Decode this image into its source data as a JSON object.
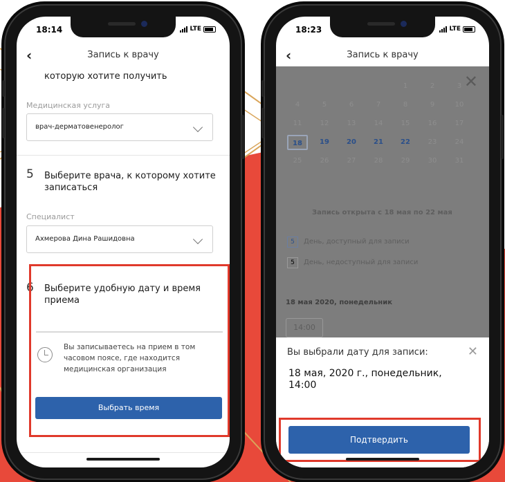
{
  "left_phone": {
    "status": {
      "time": "18:14",
      "network": "LTE"
    },
    "header": {
      "title": "Запись к врачу"
    },
    "step4": {
      "title_tail": "которую хотите получить",
      "field_label": "Медицинская услуга",
      "select_value": "врач-дерматовенеролог"
    },
    "step5": {
      "number": "5",
      "title": "Выберите врача, к которому хотите записаться",
      "field_label": "Специалист",
      "select_value": "Ахмерова Дина Рашидовна"
    },
    "step6": {
      "number": "6",
      "title": "Выберите удобную дату и время приема",
      "info": "Вы записываетесь на прием в том часовом поясе, где находится медицинская организация",
      "button": "Выбрать время"
    }
  },
  "right_phone": {
    "status": {
      "time": "18:23",
      "network": "LTE"
    },
    "header": {
      "title": "Запись к врачу"
    },
    "calendar": {
      "rows": [
        [
          "",
          "",
          "",
          "",
          "1",
          "2",
          "3"
        ],
        [
          "4",
          "5",
          "6",
          "7",
          "8",
          "9",
          "10"
        ],
        [
          "11",
          "12",
          "13",
          "14",
          "15",
          "16",
          "17"
        ],
        [
          "18",
          "19",
          "20",
          "21",
          "22",
          "23",
          "24"
        ],
        [
          "25",
          "26",
          "27",
          "28",
          "29",
          "30",
          "31"
        ]
      ],
      "available": [
        "18",
        "19",
        "20",
        "21",
        "22"
      ],
      "selected": "18",
      "open_notice": "Запись открыта с 18 мая по 22 мая",
      "legend_available": "День, доступный для записи",
      "legend_unavailable": "День, недоступный для записи",
      "legend_sample": "5",
      "day_heading": "18 мая 2020, понедельник",
      "time_slot": "14:00"
    },
    "sheet": {
      "title": "Вы выбрали дату для записи:",
      "selection": "18 мая, 2020 г., понедельник, 14:00",
      "confirm": "Подтвердить"
    }
  },
  "colors": {
    "accent_red": "#e0392b",
    "primary_blue": "#2d62ab",
    "background_red": "#e8493a",
    "gold_lines": "#d9a55a"
  }
}
